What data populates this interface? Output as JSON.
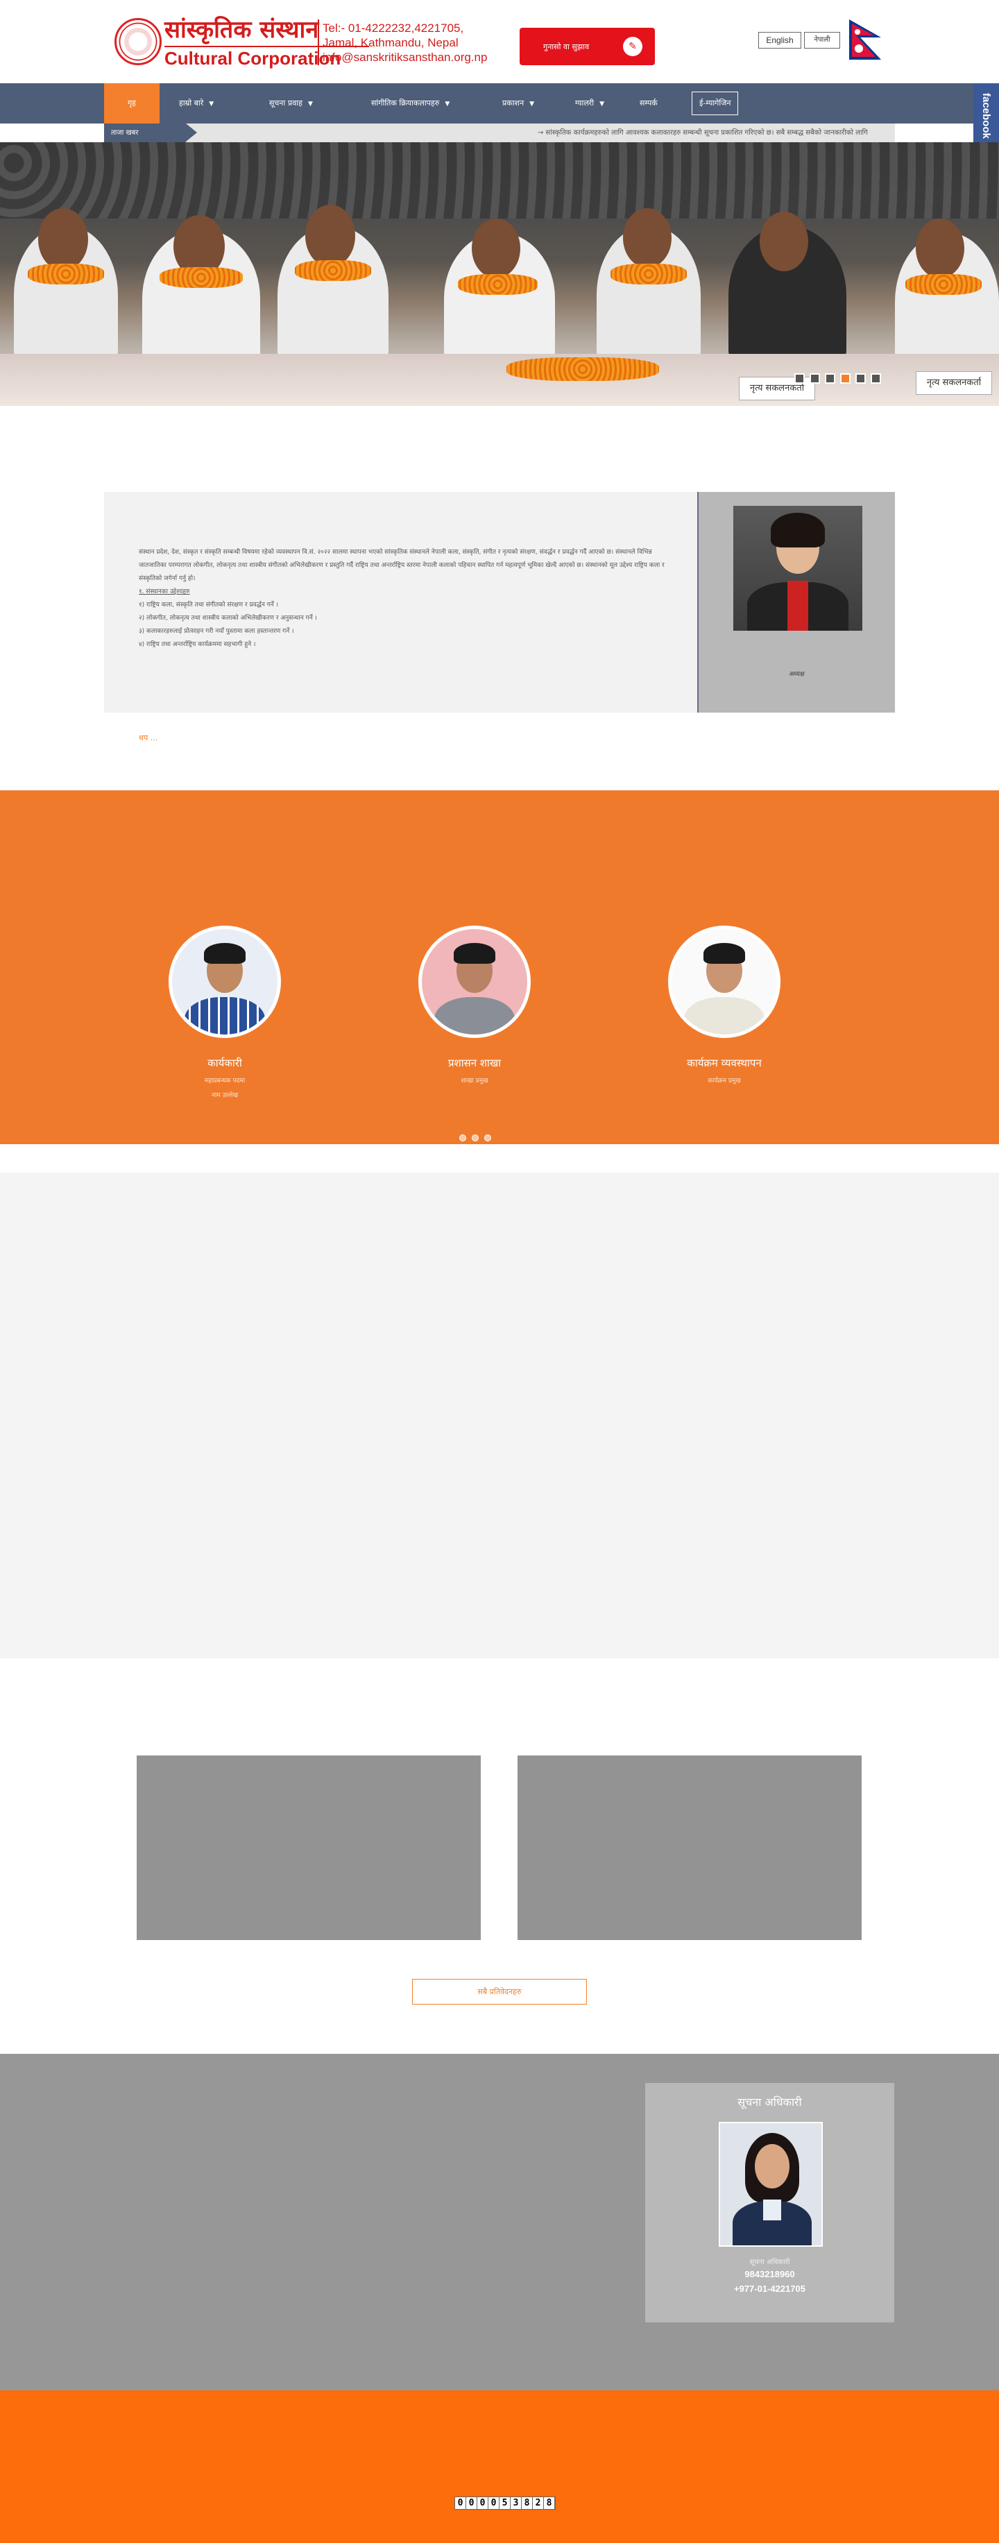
{
  "header": {
    "logo_np": "सांस्कृतिक संस्थान",
    "logo_en": "Cultural Corporation",
    "contact": [
      "Tel:- 01-4222232,4221705,",
      "Jamal, Kathmandu, Nepal",
      "info@sanskritiksansthan.org.np"
    ],
    "complaint_label": "गुनासो वा सुझाव",
    "complaint_icon": "edit-icon",
    "lang_en": "English",
    "lang_np": "नेपाली",
    "flag_colors": {
      "red": "#dc143c",
      "blue": "#003893"
    }
  },
  "nav": {
    "items": [
      {
        "label": "गृह",
        "dropdown": false
      },
      {
        "label": "हाम्रो बारे",
        "dropdown": true
      },
      {
        "label": "सूचना प्रवाह",
        "dropdown": true
      },
      {
        "label": "सांगीतिक क्रियाकलापहरु",
        "dropdown": true
      },
      {
        "label": "प्रकाशन",
        "dropdown": true
      },
      {
        "label": "ग्यालरी",
        "dropdown": true
      },
      {
        "label": "सम्पर्क",
        "dropdown": false
      }
    ],
    "emagazine": "ई-म्यागेजिन"
  },
  "facebook_tab": "facebook",
  "ticker": {
    "label": "ताजा खबर",
    "text": "→ सांस्कृतिक कार्यक्रमहरुको लागि आवश्यक कलाकारहरु सम्बन्धी सूचना प्रकाशित गरिएको छ। सबै सम्बद्ध सबैको जानकारीको लागि"
  },
  "slider": {
    "nameplates": [
      "नृत्य सकलनकर्ता",
      "नृत्य सकलनकर्ता"
    ],
    "dots_count": 6,
    "active_dot": 3
  },
  "about": {
    "paragraph": "संस्थान प्रदेश, देश, संस्कृत र संस्कृति सम्बन्धी विषयमा रहेको व्यवस्थापन वि.सं. २०२२ सालमा स्थापना भएको सांस्कृतिक संस्थानले नेपाली कला, संस्कृति, संगीत र नृत्यको संरक्षण, संवर्द्धन र प्रवर्द्धन गर्दै आएको छ। संस्थानले विभिन्न जातजातिका परम्परागत लोकगीत, लोकनृत्य तथा शास्त्रीय संगीतको अभिलेखीकरण र प्रस्तुति गर्दै राष्ट्रिय तथा अन्तर्राष्ट्रिय स्तरमा नेपाली कलाको पहिचान स्थापित गर्न महत्वपूर्ण भूमिका खेल्दै आएको छ। संस्थानको मूल उद्देश्य राष्ट्रिय कला र संस्कृतिको जगेर्ना गर्नु हो।",
    "heading": "१. संस्थानका उद्देश्यहरु",
    "objectives": [
      "१) राष्ट्रिय कला, संस्कृति तथा संगीतको संरक्षण र प्रवर्द्धन गर्ने ।",
      "२) लोकगीत, लोकनृत्य तथा शास्त्रीय कलाको अभिलेखीकरण र अनुसन्धान गर्ने ।",
      "३) कलाकारहरुलाई प्रोत्साहन गरी नयाँ पुस्तामा कला हस्तान्तरण गर्ने ।",
      "४) राष्ट्रिय तथा अन्तर्राष्ट्रिय कार्यक्रममा सहभागी हुने ।"
    ],
    "photo_caption": "अध्यक्ष",
    "read_more": "थप ..."
  },
  "team": {
    "members": [
      {
        "name": "कार्यकारी",
        "role1": "महाप्रबन्धक पदमा",
        "role2": "नाम उल्लेख"
      },
      {
        "name": "प्रशासन शाखा",
        "role1": "शाखा प्रमुख"
      },
      {
        "name": "कार्यक्रम व्यवस्थापन",
        "role1": "कार्यक्रम प्रमुख"
      }
    ],
    "dots_count": 3
  },
  "media": {
    "all_reports_label": "सबै प्रतिवेदनहरु"
  },
  "info_officer": {
    "title": "सूचना अधिकारी",
    "name": "सूचना अधिकारी",
    "mobile": "9843218960",
    "phone": "+977-01-4221705"
  },
  "footer": {
    "visitor_count": "000053828"
  }
}
